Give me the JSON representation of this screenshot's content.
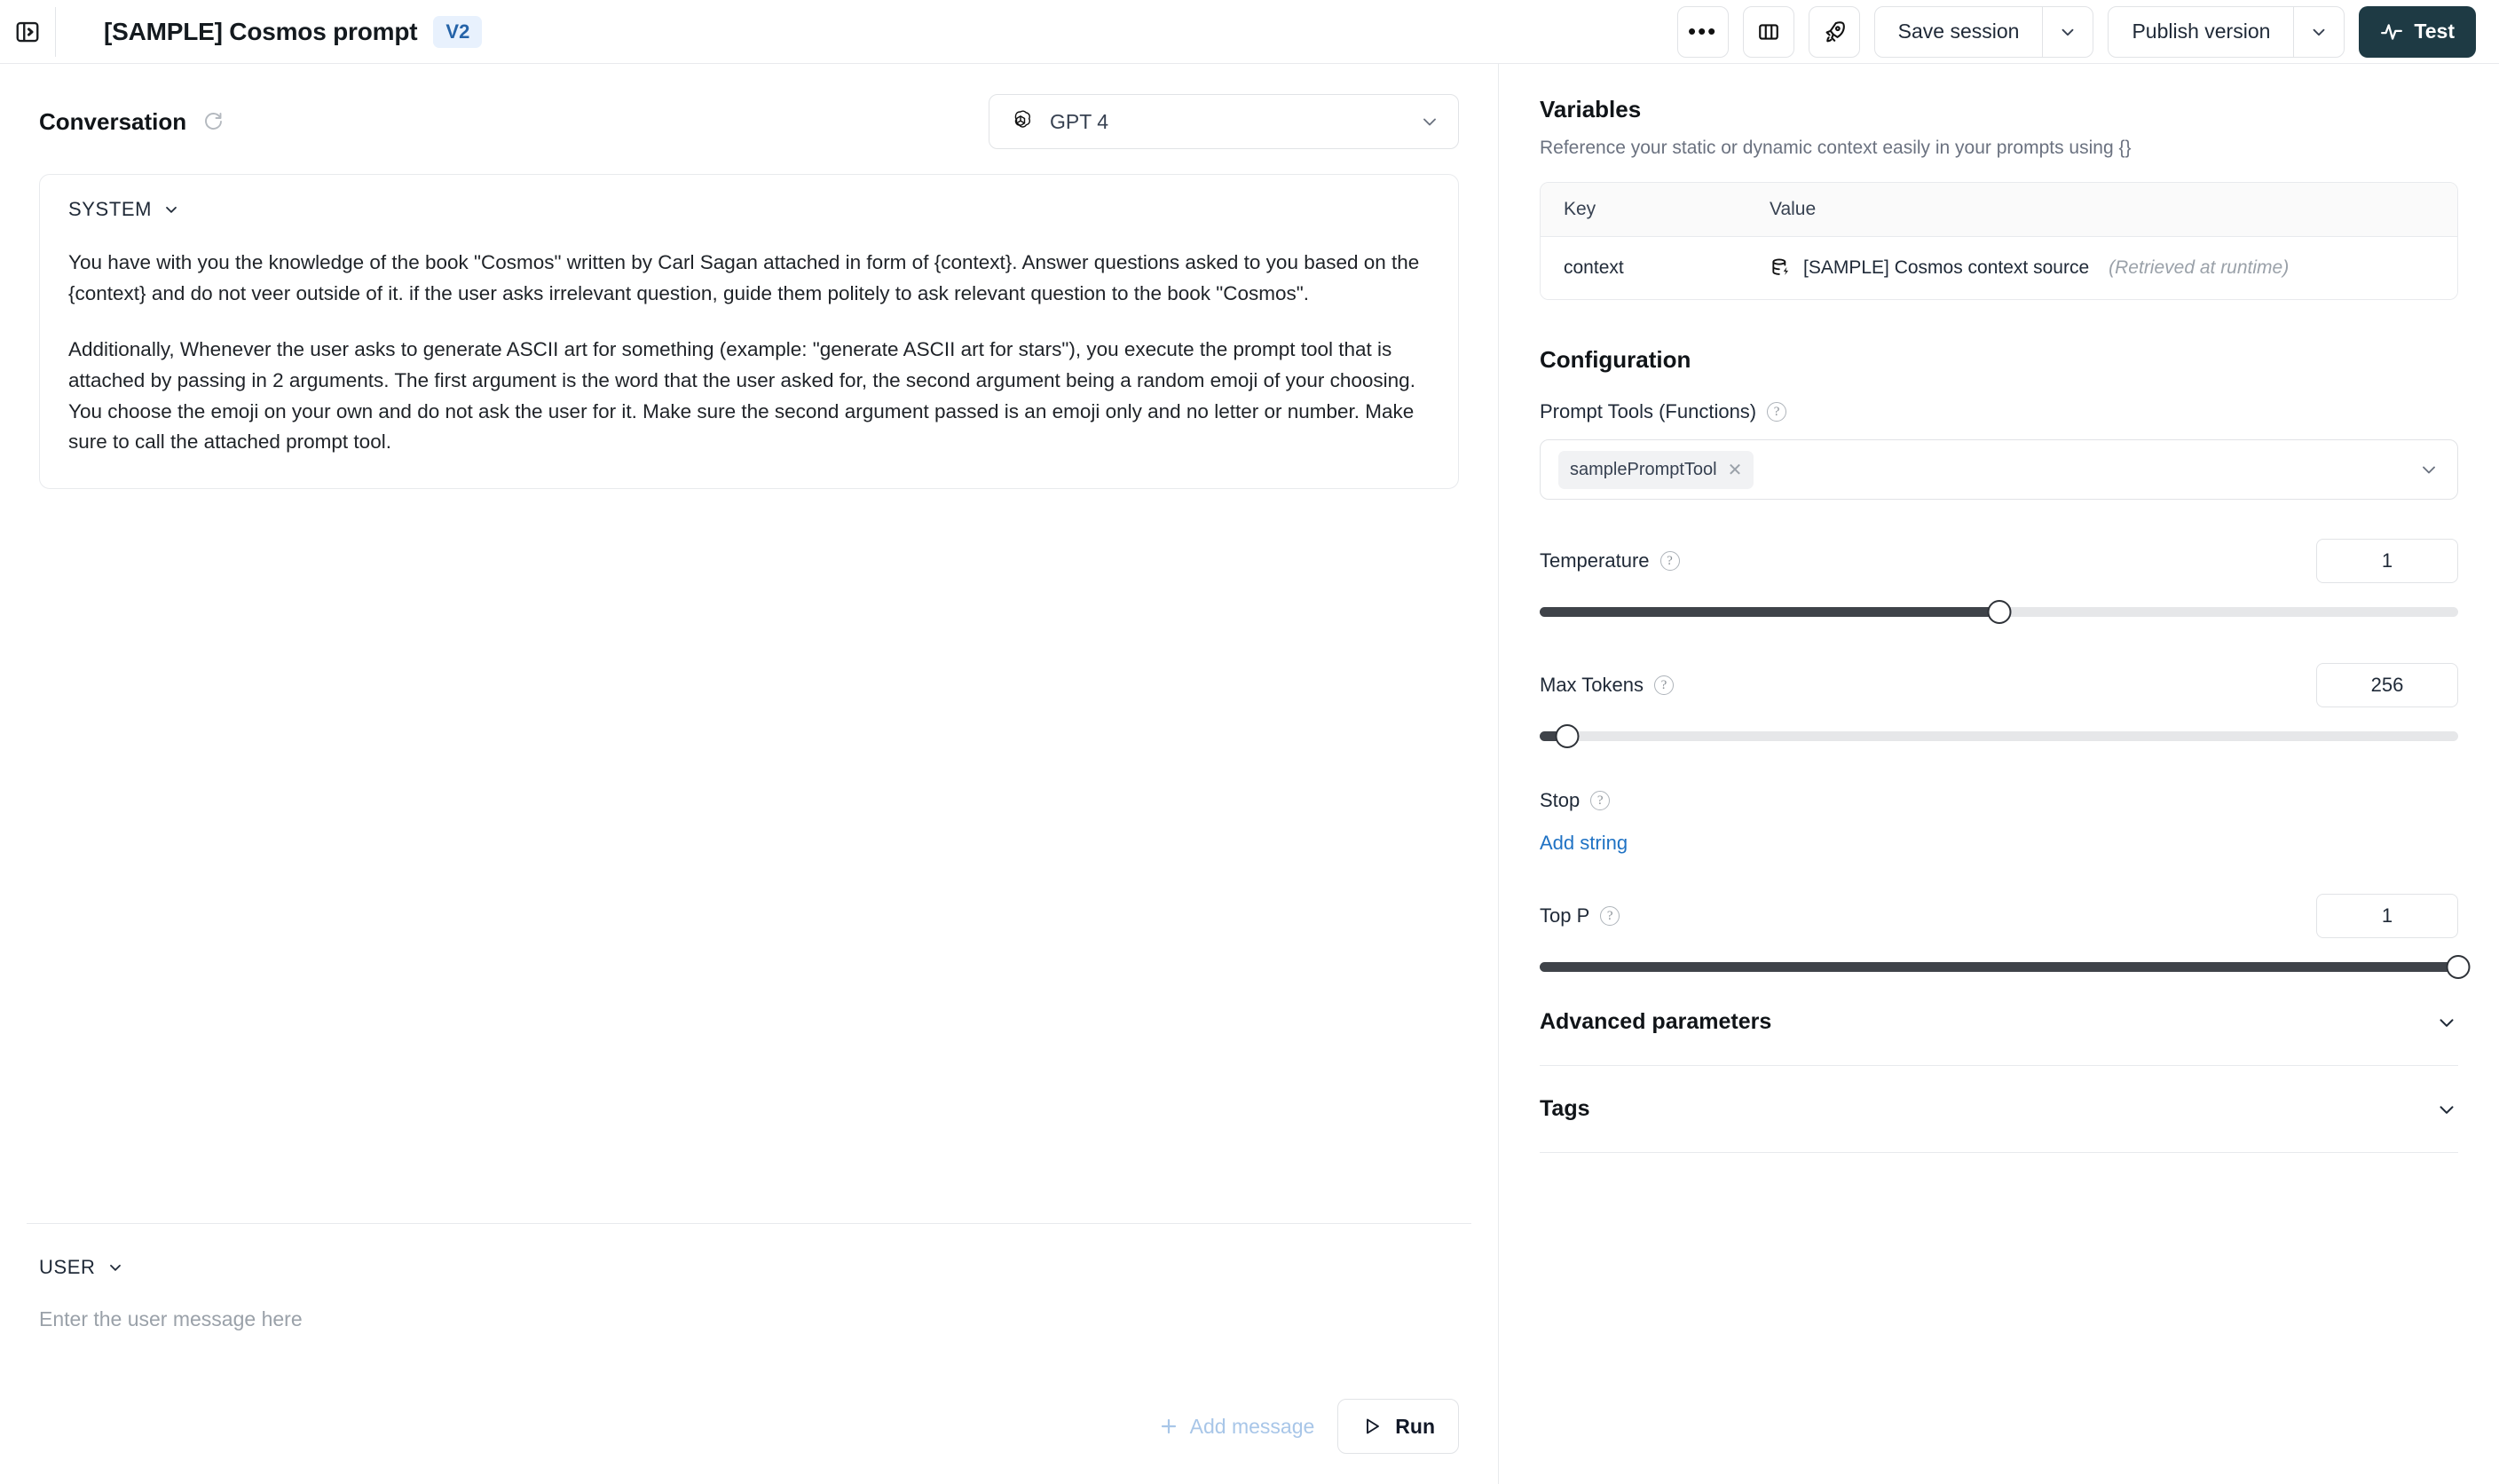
{
  "topbar": {
    "panel_toggle_icon": "panel-expand-icon",
    "title": "[SAMPLE] Cosmos prompt",
    "version_badge": "V2",
    "more_label": "•••",
    "columns_icon": "columns-icon",
    "rocket_icon": "rocket-icon",
    "save_session_label": "Save session",
    "publish_version_label": "Publish version",
    "test_label": "Test"
  },
  "conversation": {
    "title": "Conversation",
    "refresh_icon": "refresh-icon",
    "model": {
      "icon": "openai-logo-icon",
      "name": "GPT 4"
    },
    "system": {
      "role": "SYSTEM",
      "paragraph_1": "You have with you the knowledge of the book \"Cosmos\" written by Carl Sagan attached in form of {context}. Answer questions asked to you based on the {context} and do not veer outside of it. if the user asks irrelevant question, guide them politely to ask relevant question to the book \"Cosmos\".",
      "paragraph_2": "Additionally, Whenever the user asks to generate ASCII art for something (example: \"generate ASCII art for stars\"), you execute the prompt tool that is attached by passing in 2 arguments. The first argument is the word that the user asked for, the second argument being a random emoji of your choosing. You choose the emoji on your own and do not ask the user for it. Make sure the second argument passed is an emoji only and no letter or number. Make sure to call the attached prompt tool."
    },
    "user": {
      "role": "USER",
      "placeholder": "Enter the user message here",
      "value": ""
    },
    "add_message_label": "Add message",
    "run_label": "Run"
  },
  "variables": {
    "title": "Variables",
    "subtitle": "Reference your static or dynamic context easily in your prompts using {}",
    "columns": [
      "Key",
      "Value"
    ],
    "rows": [
      {
        "key": "context",
        "value_icon": "database-lightning-icon",
        "value": "[SAMPLE] Cosmos context source",
        "note": "(Retrieved at runtime)"
      }
    ]
  },
  "configuration": {
    "title": "Configuration",
    "prompt_tools": {
      "label": "Prompt Tools (Functions)",
      "chips": [
        "samplePromptTool"
      ]
    },
    "temperature": {
      "label": "Temperature",
      "value": "1",
      "percent": 50
    },
    "max_tokens": {
      "label": "Max Tokens",
      "value": "256",
      "percent": 3
    },
    "stop": {
      "label": "Stop",
      "add_string_label": "Add string"
    },
    "top_p": {
      "label": "Top P",
      "value": "1",
      "percent": 100
    },
    "advanced_parameters_label": "Advanced parameters",
    "tags_label": "Tags"
  },
  "colors": {
    "accent_dark": "#1e3a44",
    "link": "#1f72c4",
    "badge_bg": "#e8f1fd",
    "badge_text": "#2563a8"
  }
}
